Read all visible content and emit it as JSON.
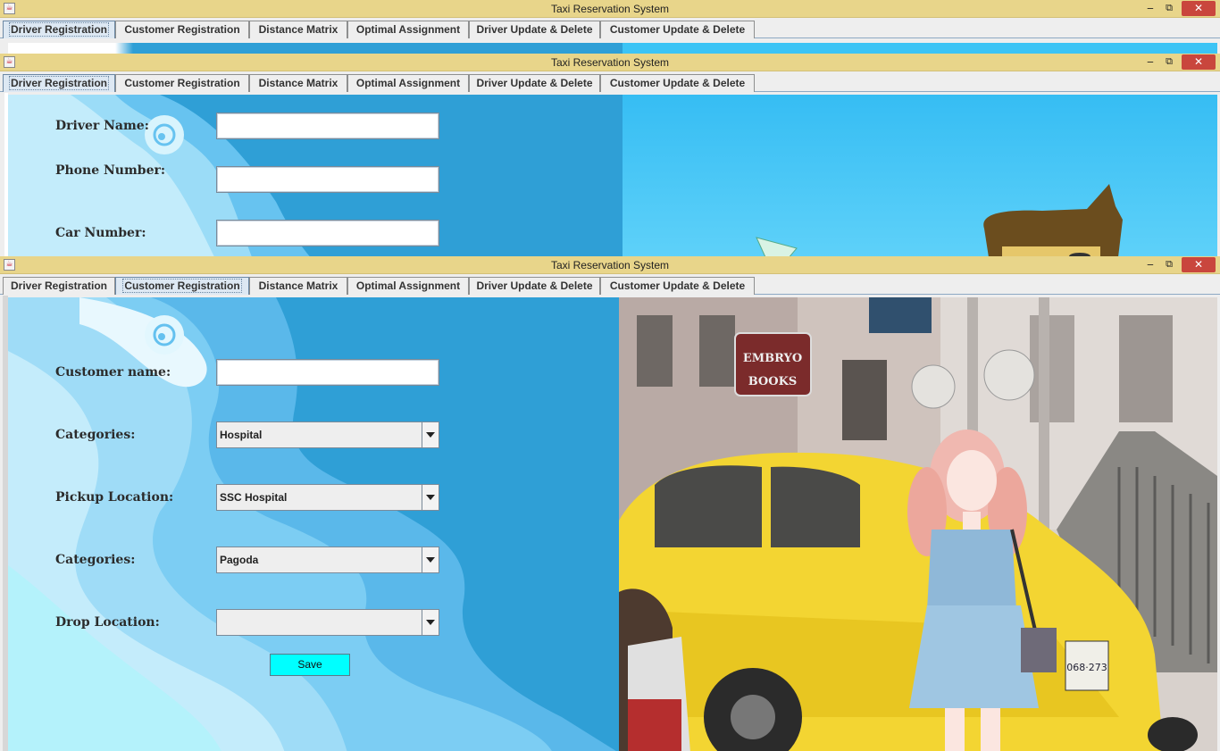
{
  "app": {
    "title": "Taxi Reservation System",
    "java_icon": "java-cup-icon"
  },
  "window_controls": {
    "minimize": "‒",
    "maximize": "⧉",
    "close": "✕"
  },
  "tabs": [
    {
      "label": "Driver Registration"
    },
    {
      "label": "Customer Registration"
    },
    {
      "label": "Distance Matrix"
    },
    {
      "label": "Optimal Assignment"
    },
    {
      "label": "Driver Update & Delete"
    },
    {
      "label": "Customer Update & Delete"
    }
  ],
  "driver_form": {
    "driver_name_label": "Driver Name:",
    "phone_label": "Phone Number:",
    "car_label": "Car Number:",
    "driver_name_value": "",
    "phone_value": "",
    "car_value": ""
  },
  "customer_form": {
    "customer_name_label": "Customer name:",
    "categories_label": "Categories:",
    "pickup_label": "Pickup Location:",
    "drop_categories_label": "Categories:",
    "drop_label": "Drop Location:",
    "customer_name_value": "",
    "categories_value": "Hospital",
    "pickup_value": "SSC Hospital",
    "drop_categories_value": "Pagoda",
    "drop_value": "",
    "save_label": "Save"
  },
  "street_photo": {
    "sign_text": "EMBRYO BOOKS",
    "plate_text": "068·273"
  },
  "colors": {
    "titlebar": "#e8d58a",
    "close": "#c9463d",
    "save_button": "#00ffff",
    "sky": "#2f9fd6"
  }
}
